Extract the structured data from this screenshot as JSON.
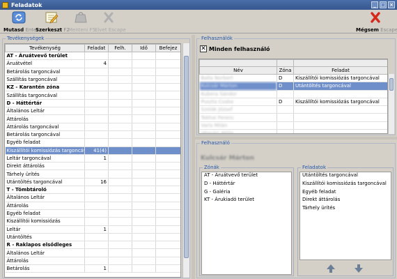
{
  "window": {
    "title": "Feladatok"
  },
  "toolbar": {
    "mutasd": {
      "label": "Mutasd",
      "key": "Enter"
    },
    "szerkeszt": {
      "label": "Szerkeszt",
      "key": "F2"
    },
    "menteni": {
      "label": "Menteni",
      "key": "F5"
    },
    "elvet": {
      "label": "Elvet",
      "key": "Escape"
    },
    "megsem": {
      "label": "Mégsem",
      "key": "Escape"
    }
  },
  "tasks": {
    "legend": "Tevékenységek",
    "columns": [
      "Tevékenység",
      "Feladat",
      "Felh.",
      "Idő",
      "Befejez"
    ],
    "rows": [
      {
        "kind": "group",
        "name": "AT - Áruátvevő terület",
        "feladat": ""
      },
      {
        "kind": "item",
        "name": "Áruátvétel",
        "feladat": "4"
      },
      {
        "kind": "item",
        "name": "Betárolás targoncával",
        "feladat": ""
      },
      {
        "kind": "item",
        "name": "Szállítás targoncával",
        "feladat": ""
      },
      {
        "kind": "group",
        "name": "KZ - Karantén zóna",
        "feladat": ""
      },
      {
        "kind": "item",
        "name": "Szállítás targoncával",
        "feladat": ""
      },
      {
        "kind": "group",
        "name": "D - Háttértár",
        "feladat": ""
      },
      {
        "kind": "item",
        "name": "Általános Leltár",
        "feladat": ""
      },
      {
        "kind": "item",
        "name": "Áttárolás",
        "feladat": ""
      },
      {
        "kind": "item",
        "name": "Áttárolás targoncával",
        "feladat": ""
      },
      {
        "kind": "item",
        "name": "Betárolás targoncával",
        "feladat": ""
      },
      {
        "kind": "item",
        "name": "Egyéb feladat",
        "feladat": ""
      },
      {
        "kind": "sel",
        "name": "Kiszállítói komissiózás targoncával",
        "feladat": "41(4)"
      },
      {
        "kind": "item",
        "name": "Leltár targoncával",
        "feladat": "1"
      },
      {
        "kind": "item",
        "name": "Direkt áttárolás",
        "feladat": ""
      },
      {
        "kind": "item",
        "name": "Tárhely ürítés",
        "feladat": ""
      },
      {
        "kind": "item",
        "name": "Utántöltés targoncával",
        "feladat": "16"
      },
      {
        "kind": "group",
        "name": "T - Tömbtároló",
        "feladat": ""
      },
      {
        "kind": "item",
        "name": "Általános Leltár",
        "feladat": ""
      },
      {
        "kind": "item",
        "name": "Áttárolás",
        "feladat": ""
      },
      {
        "kind": "item",
        "name": "Egyéb feladat",
        "feladat": ""
      },
      {
        "kind": "item",
        "name": "Kiszállítói komissiózás",
        "feladat": ""
      },
      {
        "kind": "item",
        "name": "Leltár",
        "feladat": "1"
      },
      {
        "kind": "item",
        "name": "Utántöltés",
        "feladat": ""
      },
      {
        "kind": "group",
        "name": "R - Raklapos elsődleges",
        "feladat": ""
      },
      {
        "kind": "item",
        "name": "Általános Leltár",
        "feladat": ""
      },
      {
        "kind": "item",
        "name": "Áttárolás",
        "feladat": ""
      },
      {
        "kind": "item",
        "name": "Betárolás",
        "feladat": "1"
      }
    ]
  },
  "users": {
    "legend": "Felhasználók",
    "all_label": "Minden felhasználó",
    "all_checked": true,
    "columns": [
      "Név",
      "Zóna",
      "Feladat"
    ],
    "rows": [
      {
        "name": "Balla Norbert",
        "zona": "D",
        "feladat": "Kiszállítói komissiózás targoncával",
        "sel": false
      },
      {
        "name": "Kulcsár Márton",
        "zona": "D",
        "feladat": "Utántöltés targoncával",
        "sel": true
      },
      {
        "name": "Kubera Sándor",
        "zona": "",
        "feladat": "",
        "sel": false
      },
      {
        "name": "Puszta Csaba",
        "zona": "D",
        "feladat": "Kiszállítói komissiózás targoncával",
        "sel": false
      },
      {
        "name": "Szolák József",
        "zona": "",
        "feladat": "",
        "sel": false
      },
      {
        "name": "Tokhai Ferenc",
        "zona": "",
        "feladat": "",
        "sel": false
      },
      {
        "name": "Varis Milán",
        "zona": "",
        "feladat": "",
        "sel": false
      },
      {
        "name": "Végvári Attila",
        "zona": "",
        "feladat": "",
        "sel": false
      }
    ]
  },
  "user": {
    "legend": "Felhasználó",
    "name": "Kulcsár Márton",
    "zones_legend": "Zónák",
    "zones": [
      "AT - Áruátvevő terület",
      "D - Háttértár",
      "G - Galéria",
      "KT - Árukiadó terület"
    ],
    "tasks_legend": "Feladatok",
    "tasks": [
      "Utántöltés targoncával",
      "Kiszállítói komissiózás targoncával",
      "Egyéb feladat",
      "Direkt áttárolás",
      "Tárhely ürítés"
    ]
  },
  "colors": {
    "selection": "#6f8fcb",
    "legend": "#2255aa",
    "titlebar": "#4a6ea9"
  },
  "icons": {
    "mutasd": "refresh-icon",
    "szerkeszt": "edit-icon",
    "menteni": "save-icon",
    "elvet": "discard-icon",
    "megsem": "cancel-icon",
    "up": "arrow-up-icon",
    "down": "arrow-down-icon"
  }
}
